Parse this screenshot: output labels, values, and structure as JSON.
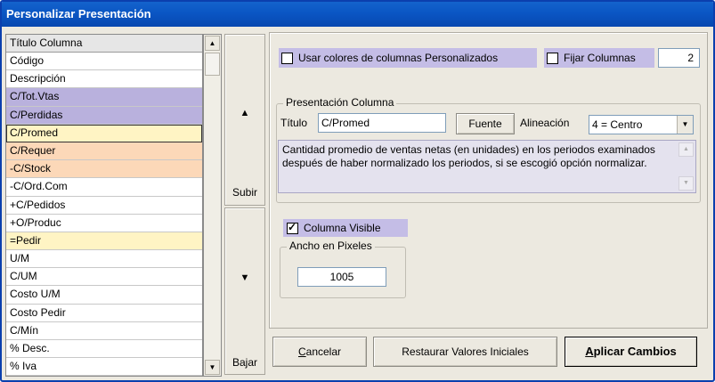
{
  "window": {
    "title": "Personalizar Presentación"
  },
  "list": {
    "header": "Título Columna",
    "rows": [
      {
        "label": "Código",
        "style": "white"
      },
      {
        "label": "Descripción",
        "style": "white"
      },
      {
        "label": "C/Tot.Vtas",
        "style": "purple"
      },
      {
        "label": "C/Perdidas",
        "style": "purple"
      },
      {
        "label": "C/Promed",
        "style": "selected"
      },
      {
        "label": "C/Requer",
        "style": "orange"
      },
      {
        "label": "-C/Stock",
        "style": "orange"
      },
      {
        "label": "-C/Ord.Com",
        "style": "white"
      },
      {
        "label": "+C/Pedidos",
        "style": "white"
      },
      {
        "label": "+O/Produc",
        "style": "white"
      },
      {
        "label": "=Pedir",
        "style": "yellow"
      },
      {
        "label": "U/M",
        "style": "white"
      },
      {
        "label": "C/UM",
        "style": "white"
      },
      {
        "label": "Costo U/M",
        "style": "white"
      },
      {
        "label": "Costo Pedir",
        "style": "white"
      },
      {
        "label": "C/Mín",
        "style": "white"
      },
      {
        "label": "% Desc.",
        "style": "white"
      },
      {
        "label": "% Iva",
        "style": "white"
      }
    ]
  },
  "move": {
    "up_label": "Subir",
    "down_label": "Bajar"
  },
  "options": {
    "custom_colors_label": "Usar colores de columnas Personalizados",
    "custom_colors_checked": false,
    "fix_columns_label": "Fijar Columnas",
    "fix_columns_checked": false,
    "fix_columns_value": "2"
  },
  "presentation": {
    "legend": "Presentación Columna",
    "title_label": "Título",
    "title_value": "C/Promed",
    "font_button": "Fuente",
    "align_label": "Alineación",
    "align_value": "4 = Centro",
    "description": "Cantidad promedio de ventas netas (en unidades) en los periodos examinados después de haber normalizado los periodos, si se escogió opción normalizar."
  },
  "visibility": {
    "label": "Columna Visible",
    "checked": true
  },
  "width": {
    "legend": "Ancho en Pixeles",
    "value": "1005"
  },
  "buttons": {
    "cancel": "Cancelar",
    "restore": "Restaurar Valores Iniciales",
    "apply": "Aplicar Cambios"
  },
  "colors": {
    "titlebar": "#0a56c4",
    "highlight_purple": "#b9b1dd",
    "highlight_orange": "#fcd8b8",
    "highlight_yellow": "#fff4c4"
  }
}
